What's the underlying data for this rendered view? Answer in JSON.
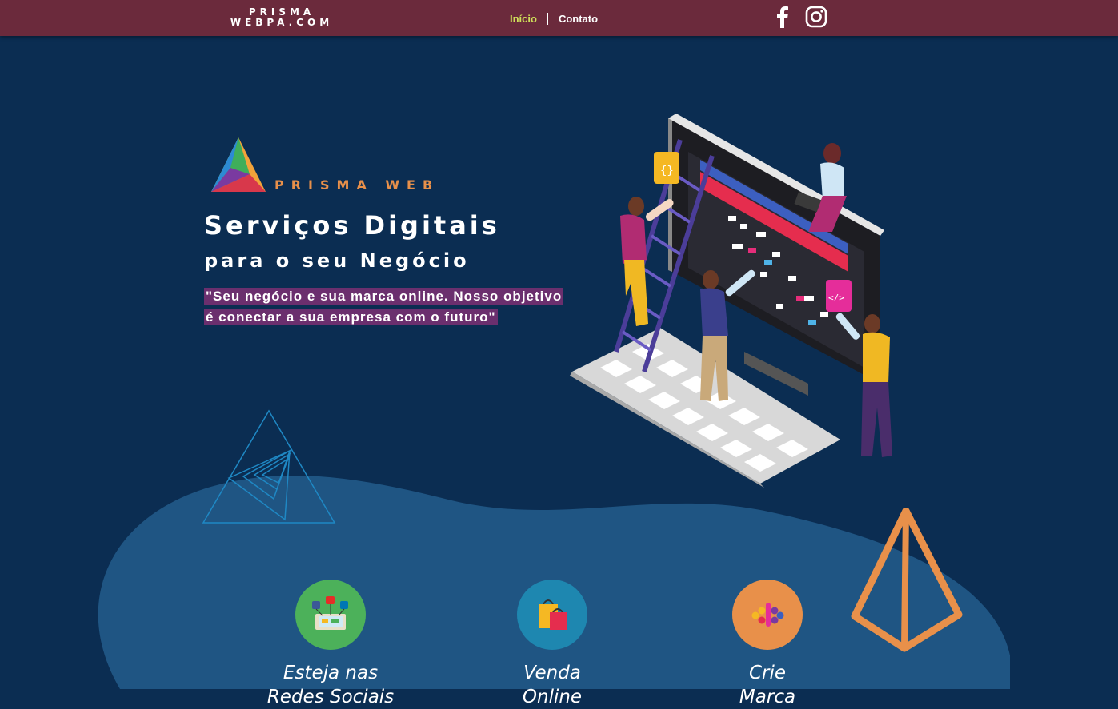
{
  "header": {
    "brand_line1": "PRISMA",
    "brand_line2": "WEBPA.COM",
    "nav": {
      "home": "Início",
      "contact": "Contato"
    },
    "social": [
      "facebook-icon",
      "instagram-icon"
    ]
  },
  "hero": {
    "logo_text": "PRISMA WEB",
    "title_line1": "Serviços Digitais",
    "title_line2": "para o seu Negócio",
    "tagline_line1": "\"Seu negócio e sua marca online. Nosso objetivo",
    "tagline_line2": "é conectar a sua empresa com o futuro\""
  },
  "services": [
    {
      "label_line1": "Esteja nas",
      "label_line2": "Redes Sociais",
      "icon": "social-media-icon",
      "color": "#4cb15a"
    },
    {
      "label_line1": "Venda",
      "label_line2": "Online",
      "icon": "shopping-bags-icon",
      "color": "#1e87b0"
    },
    {
      "label_line1": "Crie",
      "label_line2": "Marca",
      "icon": "brand-dots-icon",
      "color": "#e8904a"
    }
  ],
  "colors": {
    "background": "#0b2d52",
    "topbar": "#6b2a3c",
    "blob": "#1f5583",
    "accent_orange": "#e8904a",
    "nav_active": "#cfe05a",
    "tagline_highlight": "#6b2f6e"
  }
}
